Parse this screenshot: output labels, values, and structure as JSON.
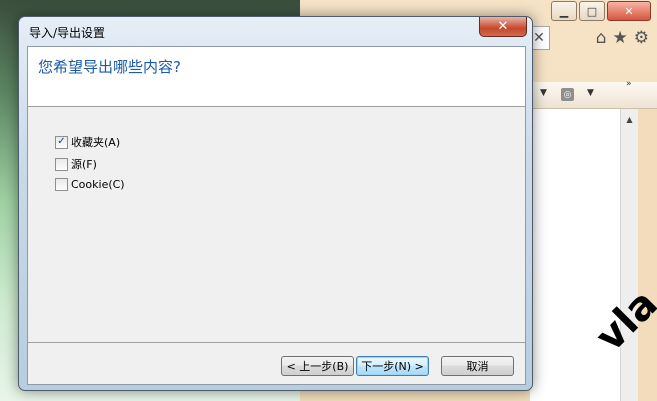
{
  "dialog": {
    "title": "导入/导出设置",
    "close_glyph": "✕",
    "heading": "您希望导出哪些内容?",
    "options": [
      {
        "label": "收藏夹(A)",
        "checked": true
      },
      {
        "label": "源(F)",
        "checked": false
      },
      {
        "label": "Cookie(C)",
        "checked": false
      }
    ],
    "buttons": {
      "back": "< 上一步(B)",
      "next": "下一步(N) >",
      "cancel": "取消"
    }
  },
  "browser": {
    "window_buttons": {
      "minimize": "▁",
      "maximize": "□",
      "close": "✕"
    },
    "address_clear_glyph": "✕",
    "icons": {
      "home": "⌂",
      "favorites": "★",
      "tools": "⚙"
    },
    "cmd_arrow": "▼",
    "rss_glyph": "◎",
    "overflow_chevron": "»",
    "scroll_up": "▲"
  },
  "watermark": "vla"
}
